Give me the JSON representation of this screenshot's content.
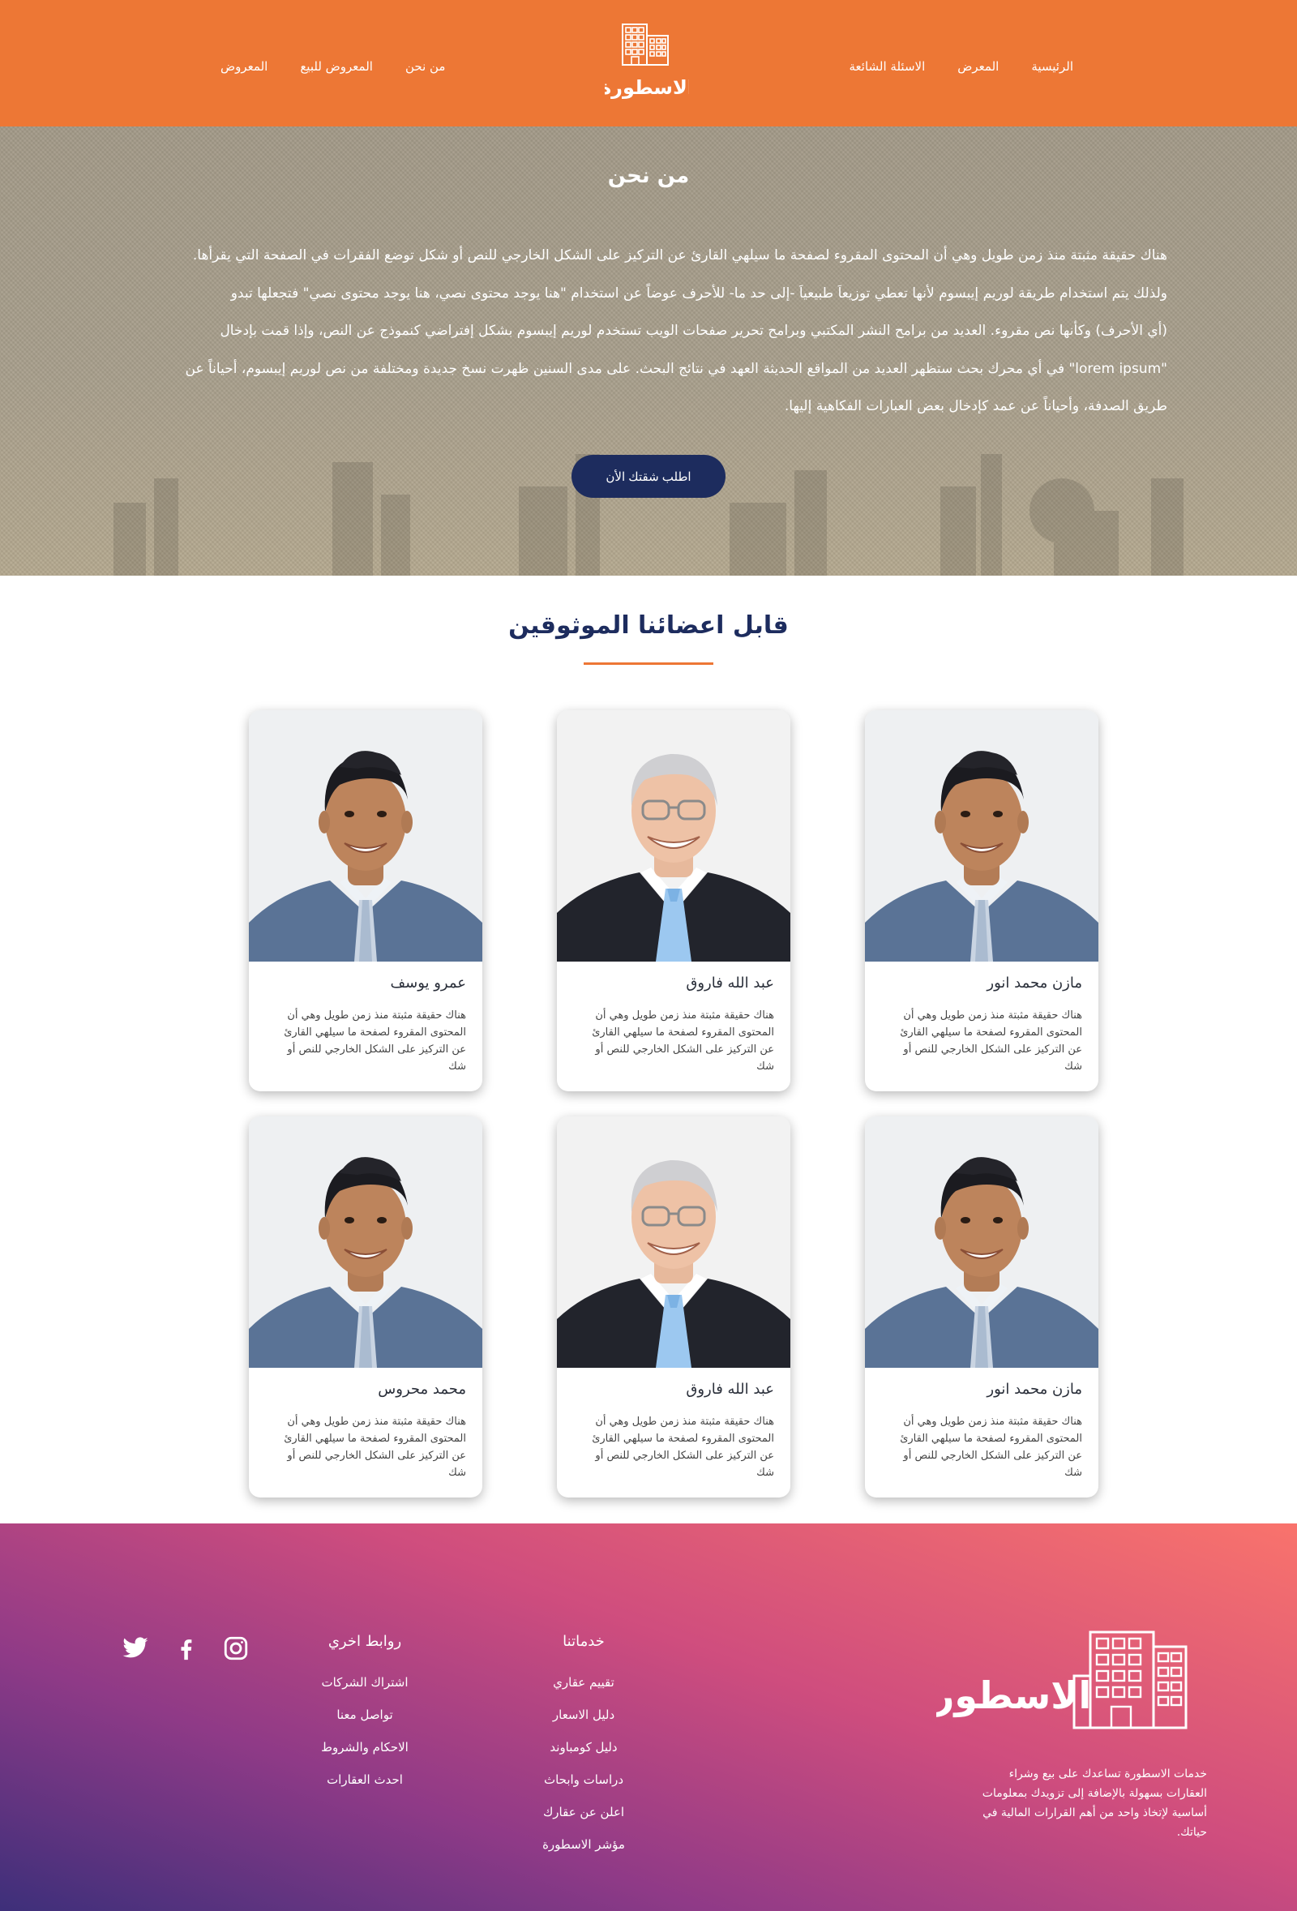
{
  "header": {
    "nav_right": [
      "الرئيسية",
      "المعرض",
      "الاسئلة الشائعة"
    ],
    "nav_left": [
      "من نحن",
      "المعروض للبيع",
      "المعروض"
    ],
    "brand_color": "#ed7735"
  },
  "hero": {
    "title": "من نحن",
    "lines": [
      "هناك حقيقة مثبتة منذ زمن طويل وهي أن المحتوى المقروء لصفحة ما سيلهي القارئ عن التركيز على الشكل الخارجي للنص أو شكل توضع الفقرات في الصفحة التي يقرأها.",
      "ولذلك يتم استخدام طريقة لوريم إيبسوم لأنها تعطي توزيعاَ طبيعياَ -إلى حد ما- للأحرف عوضاً عن استخدام \"هنا يوجد محتوى نصي، هنا يوجد محتوى نصي\" فتجعلها تبدو",
      "(أي الأحرف) وكأنها نص مقروء. العديد من برامح النشر المكتبي وبرامح تحرير صفحات الويب تستخدم لوريم إيبسوم بشكل إفتراضي كنموذج عن النص، وإذا قمت بإدخال",
      "\"lorem ipsum\" في أي محرك بحث ستظهر العديد من المواقع الحديثة العهد في نتائج البحث. على مدى السنين ظهرت نسخ جديدة ومختلفة من نص لوريم إيبسوم، أحياناً عن",
      "طريق الصدفة، وأحياناً عن عمد كإدخال بعض العبارات الفكاهية إليها."
    ],
    "cta_label": "اطلب شقتك الأن"
  },
  "members": {
    "title": "قابل اعضائنا الموثوقين",
    "accent": "#ed7735",
    "cards": [
      {
        "name": "مازن محمد انور",
        "photo": "young-man",
        "desc": "هناك حقيقة مثبتة منذ زمن طويل وهي أن المحتوى المقروء لصفحة ما سيلهي القارئ عن التركيز على الشكل الخارجي للنص أو شك"
      },
      {
        "name": "عبد الله فاروق",
        "photo": "older-man",
        "desc": "هناك حقيقة مثبتة منذ زمن طويل وهي أن المحتوى المقروء لصفحة ما سيلهي القارئ عن التركيز على الشكل الخارجي للنص أو شك"
      },
      {
        "name": "عمرو يوسف",
        "photo": "young-man",
        "desc": "هناك حقيقة مثبتة منذ زمن طويل وهي أن المحتوى المقروء لصفحة ما سيلهي القارئ عن التركيز على الشكل الخارجي للنص أو شك"
      },
      {
        "name": "مازن محمد انور",
        "photo": "young-man",
        "desc": "هناك حقيقة مثبتة منذ زمن طويل وهي أن المحتوى المقروء لصفحة ما سيلهي القارئ عن التركيز على الشكل الخارجي للنص أو شك"
      },
      {
        "name": "عبد الله فاروق",
        "photo": "older-man",
        "desc": "هناك حقيقة مثبتة منذ زمن طويل وهي أن المحتوى المقروء لصفحة ما سيلهي القارئ عن التركيز على الشكل الخارجي للنص أو شك"
      },
      {
        "name": "محمد محروس",
        "photo": "young-man",
        "desc": "هناك حقيقة مثبتة منذ زمن طويل وهي أن المحتوى المقروء لصفحة ما سيلهي القارئ عن التركيز على الشكل الخارجي للنص أو شك"
      }
    ]
  },
  "footer": {
    "about": "خدمات الاسطورة تساعدك على بيع وشراء العقارات بسهولة بالإضافة إلى تزويدك بمعلومات أساسية لإتخاذ واحد من أهم القرارات المالية في حياتك.",
    "services_title": "خدماتنا",
    "services": [
      "تقييم عقاري",
      "دليل الاسعار",
      "دليل كومباوند",
      "دراسات وابحاث",
      "اعلن عن عقارك",
      "مؤشر الاسطورة"
    ],
    "links_title": "روابط اخري",
    "links": [
      "اشتراك الشركات",
      "تواصل معنا",
      "الاحكام والشروط",
      "احدث العقارات"
    ],
    "social": [
      "instagram-icon",
      "facebook-icon",
      "twitter-icon"
    ]
  },
  "brand": {
    "logo_text": "الاسطورة"
  }
}
